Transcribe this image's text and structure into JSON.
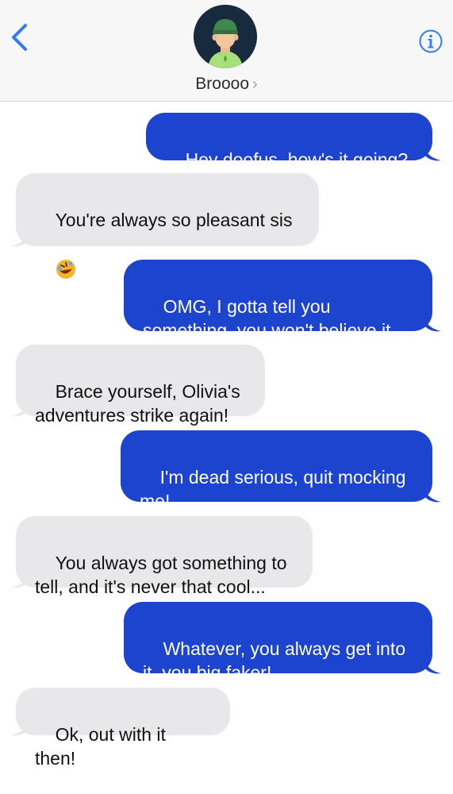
{
  "header": {
    "contact_name": "Broooo",
    "chevron": "›",
    "back_icon": "chevron-left-icon",
    "info_icon": "info-circle-icon",
    "accent_color": "#1c44cf",
    "ios_blue": "#2f7cf6"
  },
  "messages": [
    {
      "direction": "sent",
      "text": "Hey doofus, how's it going?"
    },
    {
      "direction": "received",
      "text": "You're always so pleasant sis",
      "emoji": "rolling-on-floor-laughing-emoji"
    },
    {
      "direction": "sent",
      "text": "OMG, I gotta tell you\nsomething, you won't believe it"
    },
    {
      "direction": "received",
      "text": "Brace yourself, Olivia's\nadventures strike again!"
    },
    {
      "direction": "sent",
      "text": "I'm dead serious, quit mocking\nme!"
    },
    {
      "direction": "received",
      "text": "You always got something to\ntell, and it's never that cool..."
    },
    {
      "direction": "sent",
      "text": "Whatever, you always get into\nit, you big faker!"
    },
    {
      "direction": "received",
      "text": "Ok, out with it then!"
    }
  ],
  "colors": {
    "sent_bubble": "#1c44cf",
    "received_bubble": "#e8e8ea",
    "header_bg": "#f7f7f8"
  }
}
